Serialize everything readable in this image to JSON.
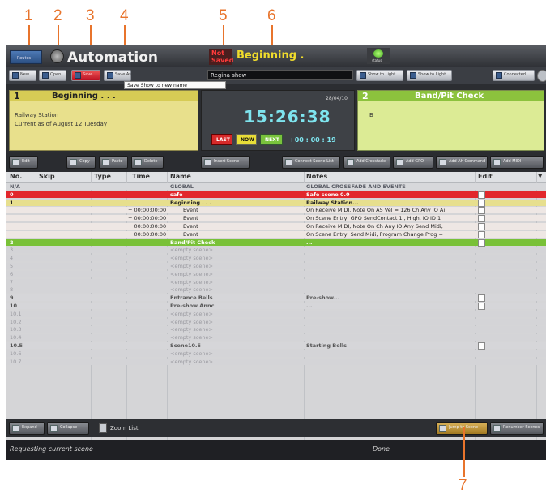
{
  "callouts": [
    "1",
    "2",
    "3",
    "4",
    "5",
    "6",
    "7"
  ],
  "app": {
    "header_tab": "Routes",
    "title": "Automation",
    "save_state": {
      "line1": "Not",
      "line2": "Saved"
    },
    "show_name": "Beginning .",
    "status_label": "status"
  },
  "toolbar": {
    "show_name_input": "Regina show",
    "tooltip": "Save Show to new name",
    "buttons": [
      "New",
      "Open",
      "Save",
      "Save As"
    ],
    "right_buttons": [
      "Show to Light",
      "Show to Light",
      "Connected"
    ]
  },
  "scene_current": {
    "number": "1",
    "title": "Beginning . . .",
    "line1": "Railway Station",
    "line2": "Current as of  August 12 Tuesday"
  },
  "scene_next": {
    "number": "2",
    "title": "Band/Pit Check",
    "line1": "B"
  },
  "clock": {
    "date": "28/04/10",
    "time": "15:26:38",
    "countdown": "+00 : 00 : 19",
    "buttons": [
      "LAST",
      "NOW",
      "NEXT"
    ]
  },
  "middle_toolbar": {
    "left_buttons": [
      "Edit",
      "Copy",
      "Paste",
      "Delete"
    ],
    "center_button": "Insert Scene",
    "right_buttons": [
      "Connect Scene List",
      "Add Crossfade",
      "Add GPO",
      "Add Ah Command",
      "Add MIDI"
    ]
  },
  "table": {
    "headers": [
      "No.",
      "Skip",
      "Type",
      "Time",
      "Name",
      "Notes",
      "Edit"
    ],
    "rows": [
      {
        "no": "N/A",
        "name": "GLOBAL",
        "notes": "GLOBAL CROSSFADE AND EVENTS",
        "kind": "global"
      },
      {
        "no": "0",
        "name": "safe",
        "notes": "Safe scene 0.0",
        "kind": "red"
      },
      {
        "no": "1",
        "name": "Beginning . . .",
        "notes": "Railway Station...",
        "kind": "yellow"
      },
      {
        "no": "",
        "time": "+ 00:00:00:00",
        "name": "Event",
        "notes": "On Receive MIDI. Note On A5 Vel = 126 Ch  Any IO Ai",
        "kind": "event",
        "type": "midi-in-icon"
      },
      {
        "no": "",
        "time": "+ 00:00:00:00",
        "name": "Event",
        "notes": "On Scene Entry,  GPO SendContact 1 , High, IO ID 1",
        "kind": "event",
        "type": "gpo-out-icon"
      },
      {
        "no": "",
        "time": "+ 00:00:00:00",
        "name": "Event",
        "notes": "On Receive MIDI, Note On  Ch  Any IO Any Send Midi,",
        "kind": "event",
        "type": "midi-in-icon"
      },
      {
        "no": "",
        "time": "+ 00:00:00:00",
        "name": "Event",
        "notes": "On Scene Entry,  Send Midi, Program Change  Prog =",
        "kind": "event",
        "type": "midi-out-icon"
      },
      {
        "no": "2",
        "name": "Band/Pit Check",
        "notes": "...",
        "kind": "green"
      },
      {
        "no": "3",
        "name": "<empty scene>",
        "notes": "",
        "kind": "empty"
      },
      {
        "no": "4",
        "name": "<empty scene>",
        "notes": "",
        "kind": "empty"
      },
      {
        "no": "5",
        "name": "<empty scene>",
        "notes": "",
        "kind": "empty"
      },
      {
        "no": "6",
        "name": "<empty scene>",
        "notes": "",
        "kind": "empty"
      },
      {
        "no": "7",
        "name": "<empty scene>",
        "notes": "",
        "kind": "empty"
      },
      {
        "no": "8",
        "name": "<empty scene>",
        "notes": "",
        "kind": "empty"
      },
      {
        "no": "9",
        "name": "Entrance Bells",
        "notes": "Pre-show...",
        "kind": "scene"
      },
      {
        "no": "10",
        "name": "Pre-show Annc",
        "notes": "...",
        "kind": "scene"
      },
      {
        "no": "10.1",
        "name": "<empty scene>",
        "notes": "",
        "kind": "empty"
      },
      {
        "no": "10.2",
        "name": "<empty scene>",
        "notes": "",
        "kind": "empty"
      },
      {
        "no": "10.3",
        "name": "<empty scene>",
        "notes": "",
        "kind": "empty"
      },
      {
        "no": "10.4",
        "name": "<empty scene>",
        "notes": "",
        "kind": "empty"
      },
      {
        "no": "10.5",
        "name": "Scene10.5",
        "notes": "Starting Bells",
        "kind": "scene"
      },
      {
        "no": "10.6",
        "name": "<empty scene>",
        "notes": "",
        "kind": "empty"
      },
      {
        "no": "10.7",
        "name": "<empty scene>",
        "notes": "",
        "kind": "empty"
      }
    ]
  },
  "bottom_toolbar": {
    "left_buttons": [
      "Expand",
      "Collapse"
    ],
    "zoom_label": "Zoom List",
    "right_buttons": [
      "Jump to Scene",
      "Renumber Scenes"
    ]
  },
  "status": {
    "left": "Requesting current scene",
    "right": "Done"
  },
  "colors": {
    "accent": "#e8742c",
    "current": "#e9e08a",
    "next": "#d9ee90",
    "safe": "#e5272d",
    "green": "#7ec432"
  }
}
